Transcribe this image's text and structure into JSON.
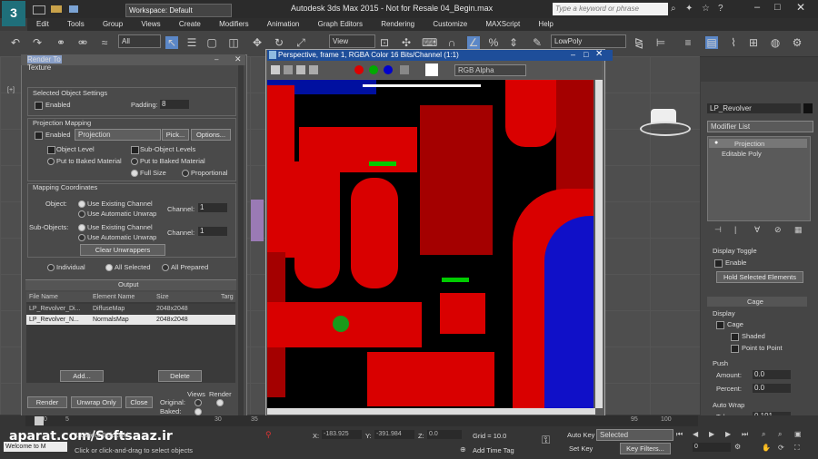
{
  "app": {
    "title": "Autodesk 3ds Max 2015 - Not for Resale   04_Begin.max",
    "workspace": "Workspace: Default",
    "search_placeholder": "Type a keyword or phrase",
    "logo": "3"
  },
  "menu": [
    "Edit",
    "Tools",
    "Group",
    "Views",
    "Create",
    "Modifiers",
    "Animation",
    "Graph Editors",
    "Rendering",
    "Customize",
    "MAXScript",
    "Help"
  ],
  "toolbar": {
    "selection_filter": "All",
    "view_dropdown": "View",
    "selection_set": "LowPoly"
  },
  "dialog": {
    "title": "Render To Texture",
    "selected_object_settings": "Selected Object Settings",
    "enabled_label": "Enabled",
    "padding_label": "Padding:",
    "padding_value": "8",
    "projection_mapping": "Projection Mapping",
    "projection_enabled_label": "Enabled",
    "projection_value": "Projection",
    "pick_button": "Pick...",
    "options_button": "Options...",
    "object_level": "Object Level",
    "sub_object_levels": "Sub-Object Levels",
    "put_to_baked_1": "Put to Baked Material",
    "put_to_baked_2": "Put to Baked Material",
    "full_size": "Full Size",
    "proportional": "Proportional",
    "mapping_coordinates": "Mapping Coordinates",
    "object_label": "Object:",
    "use_existing_1": "Use Existing Channel",
    "use_auto_1": "Use Automatic Unwrap",
    "channel_label_1": "Channel:",
    "channel_value_1": "1",
    "subobjects_label": "Sub-Objects:",
    "use_existing_2": "Use Existing Channel",
    "use_auto_2": "Use Automatic Unwrap",
    "channel_label_2": "Channel:",
    "channel_value_2": "1",
    "clear_unwrappers": "Clear Unwrappers",
    "individual": "Individual",
    "all_selected": "All Selected",
    "all_prepared": "All Prepared",
    "output_header": "Output",
    "columns": [
      "File Name",
      "Element Name",
      "Size",
      "Targ"
    ],
    "rows": [
      [
        "LP_Revolver_Di...",
        "DiffuseMap",
        "2048x2048",
        ""
      ],
      [
        "LP_Revolver_N...",
        "NormalsMap",
        "2048x2048",
        ""
      ]
    ],
    "add_button": "Add...",
    "delete_button": "Delete",
    "render_button": "Render",
    "unwrap_only_button": "Unwrap Only",
    "close_button": "Close",
    "views_label": "Views",
    "render_label": "Render",
    "original_label": "Original:",
    "baked_label": "Baked:"
  },
  "frame_window": {
    "title": "Perspective, frame 1, RGBA Color 16 Bits/Channel (1:1)",
    "channel_dropdown": "RGB Alpha"
  },
  "panel": {
    "object_name": "LP_Revolver",
    "modifier_list": "Modifier List",
    "stack": [
      "Projection",
      "Editable Poly"
    ],
    "display_toggle": "Display Toggle",
    "enable": "Enable",
    "hold_button": "Hold Selected Elements",
    "cage_header": "Cage",
    "display_label": "Display",
    "cage_label": "Cage",
    "shaded_label": "Shaded",
    "point_to_point_label": "Point to Point",
    "push_label": "Push",
    "amount_label": "Amount:",
    "amount_value": "0.0",
    "percent_label": "Percent:",
    "percent_value": "0.0",
    "auto_wrap_label": "Auto Wrap",
    "tolerance_label": "Tolerance:",
    "tolerance_value": "0.191"
  },
  "status": {
    "welcome": "Welcome to M",
    "object_selected": "1 Object Selected",
    "hint": "Click or click-and-drag to select objects",
    "x_label": "X:",
    "x_value": "-183.925",
    "y_label": "Y:",
    "y_value": "-391.984",
    "z_label": "Z:",
    "z_value": "0.0",
    "grid": "Grid = 10.0",
    "add_time_tag": "Add Time Tag",
    "auto_key": "Auto Key",
    "selected": "Selected",
    "set_key": "Set Key",
    "key_filters": "Key Filters...",
    "frame": "0",
    "watermark": "aparat.com/Softsaaz.ir"
  },
  "timeline_ticks": [
    "0",
    "5",
    "30",
    "35",
    "95",
    "100"
  ]
}
